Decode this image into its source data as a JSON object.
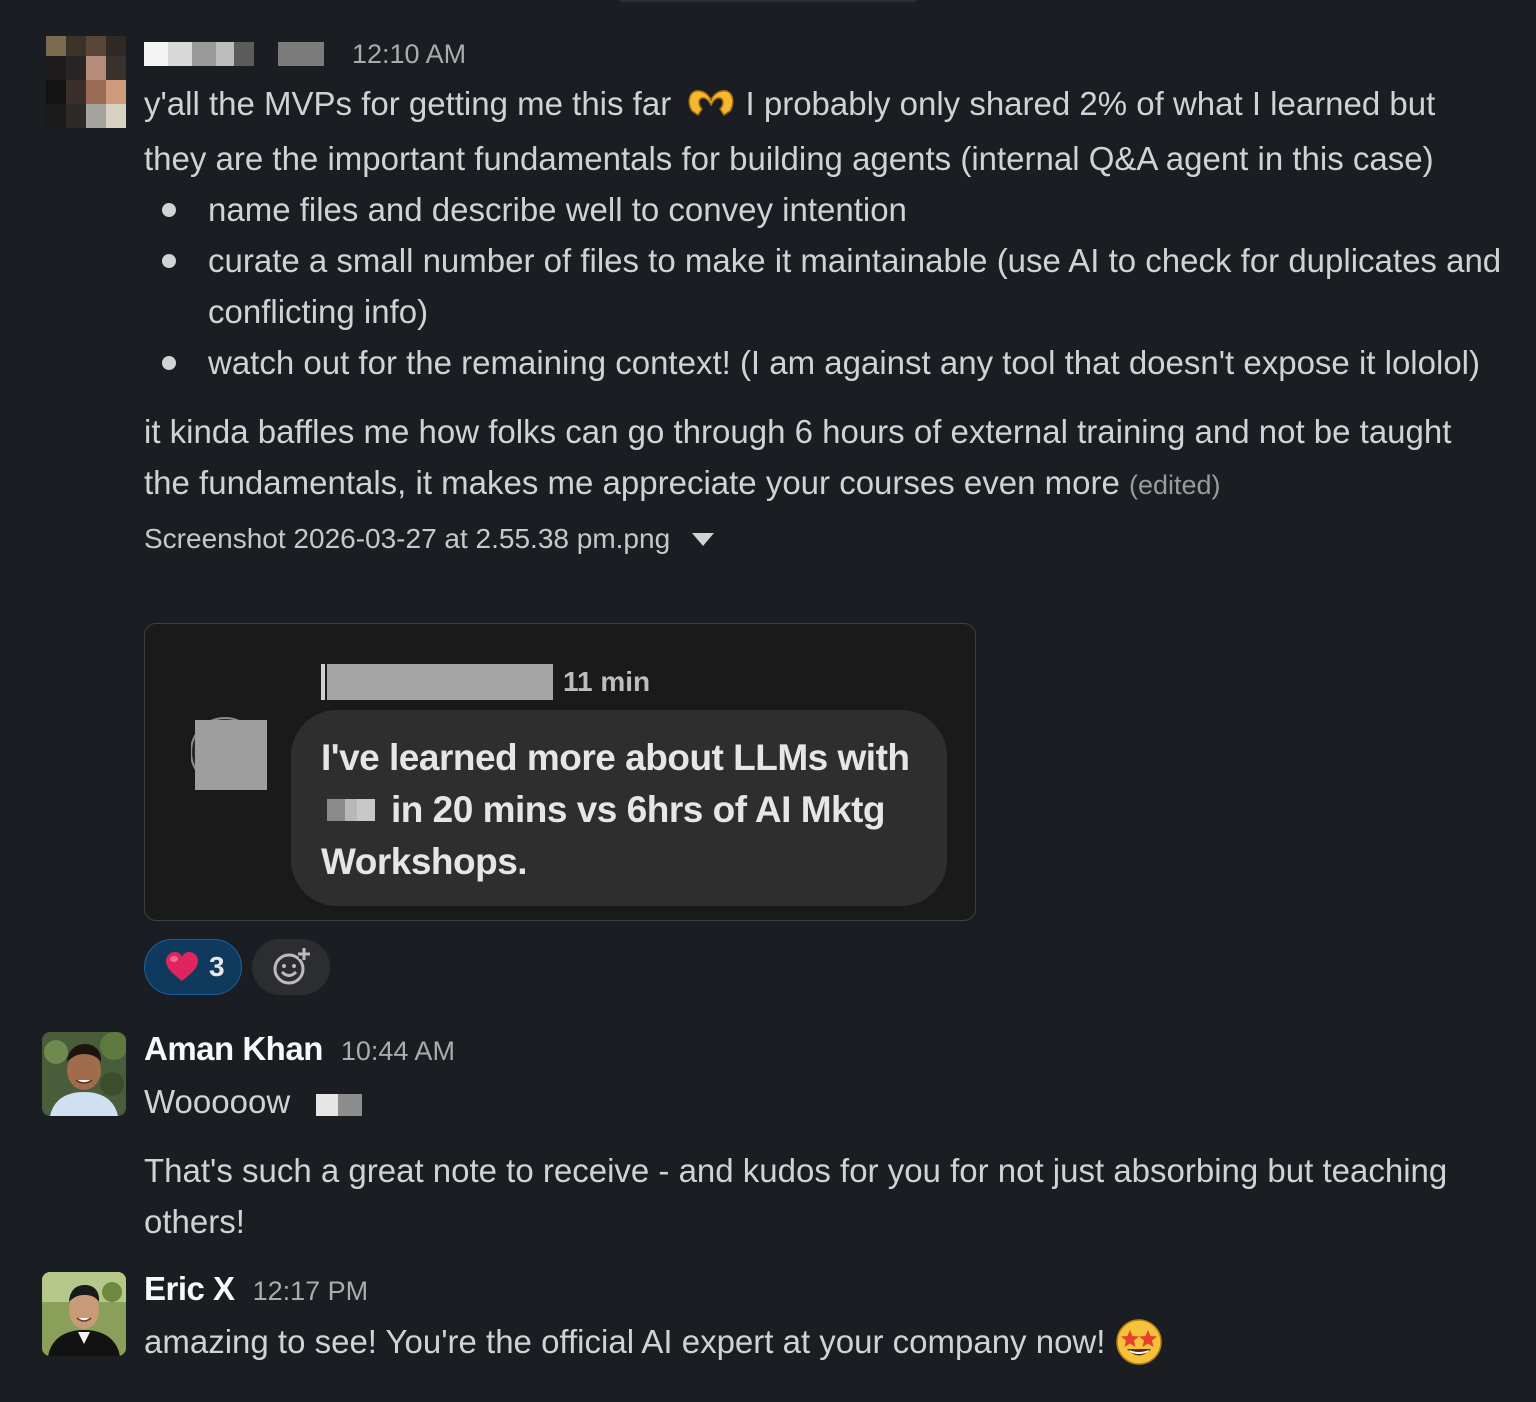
{
  "messages": [
    {
      "author": "",
      "time": "12:10 AM",
      "intro": "y'all the MVPs for getting me this far",
      "intro_emoji": "heart-hands-emoji",
      "intro_rest": " I probably only shared 2% of what I learned but they are the important fundamentals for building agents (internal Q&A agent in this case)",
      "bullets": [
        "name files and describe well to convey intention",
        "curate a small number of files to make it maintainable (use AI to check for duplicates and conflicting info)",
        "watch out for the remaining context! (I am against any tool that doesn't expose it lololol)"
      ],
      "paragraph": "it kinda baffles me how folks can go through 6 hours of external training and not be taught the fundamentals, it makes me appreciate your courses even more",
      "edited": "(edited)",
      "attachment": {
        "filename": "Screenshot 2026-03-27 at 2.55.38 pm.png",
        "time": "11 min",
        "line1": "I've learned more about LLMs with",
        "line2": "in 20 mins vs 6hrs of AI Mktg",
        "line3": "Workshops."
      },
      "reactions": [
        {
          "emoji": "red-heart-emoji",
          "count": "3"
        }
      ]
    },
    {
      "author": "Aman Khan",
      "time": "10:44 AM",
      "line1": "Wooooow",
      "line2": "That's such a great note to receive - and kudos for you for not just absorbing but teaching others!"
    },
    {
      "author": "Eric X",
      "time": "12:17 PM",
      "text": "amazing to see! You're the official AI expert at your company now!",
      "emoji": "star-struck-emoji"
    }
  ],
  "colors": {
    "background": "#1a1d21",
    "text": "#d1d2d3",
    "reaction_active_bg": "#10395e",
    "heart": "#e0245e"
  }
}
